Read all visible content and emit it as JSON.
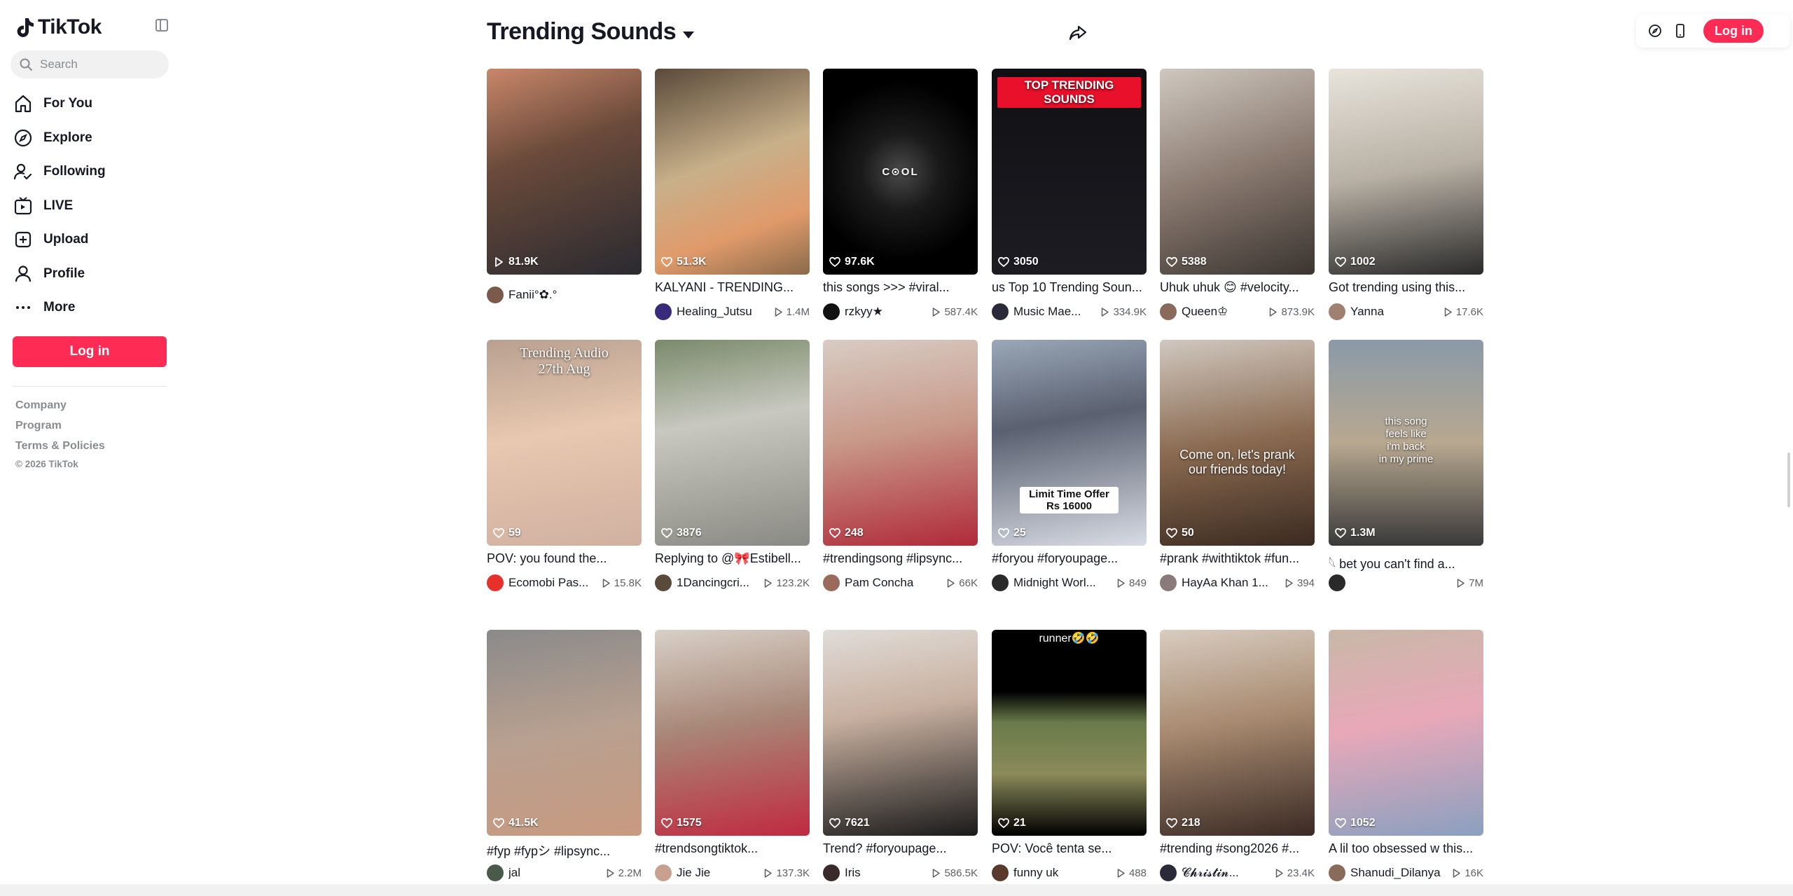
{
  "app": {
    "name": "TikTok"
  },
  "search": {
    "placeholder": "Search"
  },
  "nav": [
    {
      "label": "For You",
      "icon": "home-icon"
    },
    {
      "label": "Explore",
      "icon": "compass-icon"
    },
    {
      "label": "Following",
      "icon": "following-icon"
    },
    {
      "label": "LIVE",
      "icon": "live-icon"
    },
    {
      "label": "Upload",
      "icon": "upload-icon"
    },
    {
      "label": "Profile",
      "icon": "profile-icon"
    },
    {
      "label": "More",
      "icon": "more-icon"
    }
  ],
  "sidebar": {
    "login_label": "Log in",
    "footer": [
      "Company",
      "Program",
      "Terms & Policies"
    ],
    "copyright": "© 2026 TikTok"
  },
  "header": {
    "title": "Trending Sounds",
    "login_label": "Log in"
  },
  "colors": {
    "accent": "#fe2c55",
    "text": "#161823",
    "muted": "#8a8b91"
  },
  "videos": [
    {
      "stat": "81.9K",
      "stat_icon": "play-icon",
      "caption": "",
      "author": "Fanii°✿.°",
      "plays": "",
      "bg": "linear-gradient(160deg,#c9876a 0%,#6a4a3a 40%,#2a2a30 100%)",
      "avatar": "#7a5a4a"
    },
    {
      "stat": "51.3K",
      "stat_icon": "heart-icon",
      "caption": "KALYANI - TRENDING...",
      "author": "Healing_Jutsu",
      "plays": "1.4M",
      "bg": "linear-gradient(160deg,#5a4a3a 0%,#c8b08a 45%,#e09a6a 75%,#8a6a4a 100%)",
      "avatar": "#3a2a7a"
    },
    {
      "stat": "97.6K",
      "stat_icon": "heart-icon",
      "caption": "this songs >>> #viral...",
      "author": "rzkyy★",
      "plays": "587.4K",
      "bg": "radial-gradient(circle at 50% 50%,#4a4a4a 0%,#1a1a1a 30%,#000 70%)",
      "avatar": "#111111",
      "overlay": "C⊙OL"
    },
    {
      "stat": "3050",
      "stat_icon": "heart-icon",
      "caption": "us Top 10 Trending Soun...",
      "author": "Music Mae...",
      "plays": "334.9K",
      "bg": "linear-gradient(180deg,#101014 0%,#1c1c22 100%)",
      "avatar": "#2a2a3a",
      "overlay": "TOP TRENDING SOUNDS"
    },
    {
      "stat": "5388",
      "stat_icon": "heart-icon",
      "caption": "Uhuk uhuk 😊 #velocity...",
      "author": "Queen♔",
      "plays": "873.9K",
      "bg": "linear-gradient(160deg,#cfc8c0 0%,#8a7a70 50%,#3a3430 100%)",
      "avatar": "#8a6a5a"
    },
    {
      "stat": "1002",
      "stat_icon": "heart-icon",
      "caption": "Got trending using this...",
      "author": "Yanna",
      "plays": "17.6K",
      "bg": "linear-gradient(170deg,#e8e4dc 0%,#b8b0a4 50%,#2a2a2a 100%)",
      "avatar": "#a08070"
    },
    {
      "stat": "59",
      "stat_icon": "heart-icon",
      "caption": "POV: you found the...",
      "author": "Ecomobi Pas...",
      "plays": "15.8K",
      "bg": "linear-gradient(170deg,#b8a090 0%,#e8c8b0 45%,#d0b0a0 100%)",
      "avatar": "#e8302a",
      "overlay": "Trending Audio\n27th Aug"
    },
    {
      "stat": "3876",
      "stat_icon": "heart-icon",
      "caption": "Replying to @🎀Estibell...",
      "author": "1Dancingcri...",
      "plays": "123.2K",
      "bg": "linear-gradient(170deg,#7a8a6a 0%,#c8c8c0 40%,#8a8a84 100%)",
      "avatar": "#5a4a3a"
    },
    {
      "stat": "248",
      "stat_icon": "heart-icon",
      "caption": "#trendingsong #lipsync...",
      "author": "Pam Concha",
      "plays": "66K",
      "bg": "linear-gradient(170deg,#d8ccc4 0%,#c89a8a 45%,#b02a3a 100%)",
      "avatar": "#9a6a5a"
    },
    {
      "stat": "25",
      "stat_icon": "heart-icon",
      "caption": "#foryou #foryoupage...",
      "author": "Midnight Worl...",
      "plays": "849",
      "bg": "linear-gradient(170deg,#9aa8b8 0%,#5a6070 40%,#d8dce4 100%)",
      "avatar": "#2a2a2a",
      "overlay": "Limit Time Offer\nRs 16000"
    },
    {
      "stat": "50",
      "stat_icon": "heart-icon",
      "caption": "#prank #withtiktok #fun...",
      "author": "HayAa Khan 1...",
      "plays": "394",
      "bg": "linear-gradient(170deg,#d0c8c0 0%,#8a6a50 50%,#3a2a20 100%)",
      "avatar": "#8a7a7a",
      "overlay": "Come on, let's prank\nour friends today!"
    },
    {
      "stat": "1.3M",
      "stat_icon": "heart-icon",
      "caption": "𓆩 bet you can't find a...",
      "author": "",
      "plays": "7M",
      "bg": "linear-gradient(180deg,#8a9aa8 0%,#b8a890 50%,#3a3a3a 100%)",
      "avatar": "#2a2a2a",
      "overlay": "this song\nfeels like\ni'm back\nin my prime"
    },
    {
      "stat": "41.5K",
      "stat_icon": "heart-icon",
      "caption": "#fyp #fypシ #lipsync...",
      "author": "jal",
      "plays": "2.2M",
      "bg": "linear-gradient(170deg,#8a8a8a 0%,#b8a090 50%,#c89a80 100%)",
      "avatar": "#4a5a4a"
    },
    {
      "stat": "1575",
      "stat_icon": "heart-icon",
      "caption": "#trendsongtiktok...",
      "author": "Jie Jie",
      "plays": "137.3K",
      "bg": "linear-gradient(170deg,#d8d0c8 0%,#a88878 45%,#c02a40 100%)",
      "avatar": "#c8a090"
    },
    {
      "stat": "7621",
      "stat_icon": "heart-icon",
      "caption": "Trend? #foryoupage...",
      "author": "Iris",
      "plays": "586.5K",
      "bg": "linear-gradient(170deg,#e0dcd8 0%,#c8b0a0 40%,#1a1a1a 100%)",
      "avatar": "#3a2a2a"
    },
    {
      "stat": "21",
      "stat_icon": "heart-icon",
      "caption": "POV: Você tenta se...",
      "author": "funny uk",
      "plays": "488",
      "bg": "linear-gradient(180deg,#000 0%,#000 30%,#6a7a4a 45%,#8a8a5a 70%,#000 100%)",
      "avatar": "#5a3a2a",
      "overlay": "runner🤣🤣"
    },
    {
      "stat": "218",
      "stat_icon": "heart-icon",
      "caption": "#trending #song2026 #...",
      "author": "𝓒𝓱𝓻𝓲𝓼𝓽𝓲𝓷...",
      "plays": "23.4K",
      "bg": "linear-gradient(170deg,#d8ccc0 0%,#a88a70 45%,#3a2a24 100%)",
      "avatar": "#2a2a3a"
    },
    {
      "stat": "1052",
      "stat_icon": "heart-icon",
      "caption": "A lil too obsessed w this...",
      "author": "Shanudi_Dilanya",
      "plays": "16K",
      "bg": "linear-gradient(170deg,#c8b8a8 0%,#e8a8b8 45%,#8aa0c0 100%)",
      "avatar": "#8a6a5a"
    }
  ]
}
